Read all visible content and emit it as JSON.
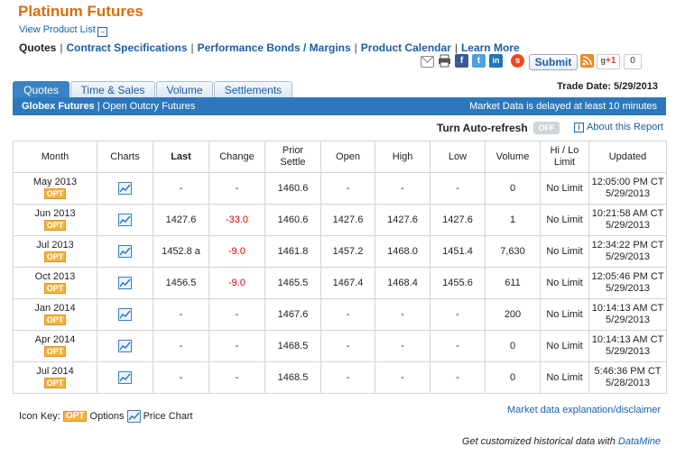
{
  "title": "Platinum Futures",
  "view_product_list": "View Product List",
  "nav": [
    {
      "label": "Quotes",
      "current": true
    },
    {
      "label": "Contract Specifications"
    },
    {
      "label": "Performance Bonds / Margins"
    },
    {
      "label": "Product Calendar"
    },
    {
      "label": "Learn More"
    }
  ],
  "social": {
    "submit_label": "Submit",
    "plus_label": "+1",
    "plus_count": "0"
  },
  "tabs": [
    "Quotes",
    "Time & Sales",
    "Volume",
    "Settlements"
  ],
  "trade_date": "Trade Date: 5/29/2013",
  "bar": {
    "globex": "Globex Futures",
    "outcry": "Open Outcry Futures",
    "delay": "Market Data is delayed at least 10 minutes"
  },
  "auto_refresh": {
    "label": "Turn Auto-refresh",
    "state": "OFF"
  },
  "about": "About this Report",
  "columns": [
    "Month",
    "Charts",
    "Last",
    "Change",
    "Prior Settle",
    "Open",
    "High",
    "Low",
    "Volume",
    "Hi / Lo Limit",
    "Updated"
  ],
  "opt_label": "OPT",
  "rows": [
    {
      "month": "May 2013",
      "last": "-",
      "change": "-",
      "prior": "1460.6",
      "open": "-",
      "high": "-",
      "low": "-",
      "volume": "0",
      "limit": "No Limit",
      "time": "12:05:00 PM CT",
      "date": "5/29/2013"
    },
    {
      "month": "Jun 2013",
      "last": "1427.6",
      "change": "-33.0",
      "prior": "1460.6",
      "open": "1427.6",
      "high": "1427.6",
      "low": "1427.6",
      "volume": "1",
      "limit": "No Limit",
      "time": "10:21:58 AM CT",
      "date": "5/29/2013"
    },
    {
      "month": "Jul 2013",
      "last": "1452.8 a",
      "change": "-9.0",
      "prior": "1461.8",
      "open": "1457.2",
      "high": "1468.0",
      "low": "1451.4",
      "volume": "7,630",
      "limit": "No Limit",
      "time": "12:34:22 PM CT",
      "date": "5/29/2013"
    },
    {
      "month": "Oct 2013",
      "last": "1456.5",
      "change": "-9.0",
      "prior": "1465.5",
      "open": "1467.4",
      "high": "1468.4",
      "low": "1455.6",
      "volume": "611",
      "limit": "No Limit",
      "time": "12:05:46 PM CT",
      "date": "5/29/2013"
    },
    {
      "month": "Jan 2014",
      "last": "-",
      "change": "-",
      "prior": "1467.6",
      "open": "-",
      "high": "-",
      "low": "-",
      "volume": "200",
      "limit": "No Limit",
      "time": "10:14:13 AM CT",
      "date": "5/29/2013"
    },
    {
      "month": "Apr 2014",
      "last": "-",
      "change": "-",
      "prior": "1468.5",
      "open": "-",
      "high": "-",
      "low": "-",
      "volume": "0",
      "limit": "No Limit",
      "time": "10:14:13 AM CT",
      "date": "5/29/2013"
    },
    {
      "month": "Jul 2014",
      "last": "-",
      "change": "-",
      "prior": "1468.5",
      "open": "-",
      "high": "-",
      "low": "-",
      "volume": "0",
      "limit": "No Limit",
      "time": "5:46:36 PM CT",
      "date": "5/28/2013"
    }
  ],
  "icon_key": {
    "label": "Icon Key:",
    "opt": "OPT",
    "options": "Options",
    "price_chart": "Price Chart"
  },
  "disclaimer": "Market data explanation/disclaimer",
  "historical": {
    "text": "Get customized historical data with",
    "link": "DataMine"
  }
}
